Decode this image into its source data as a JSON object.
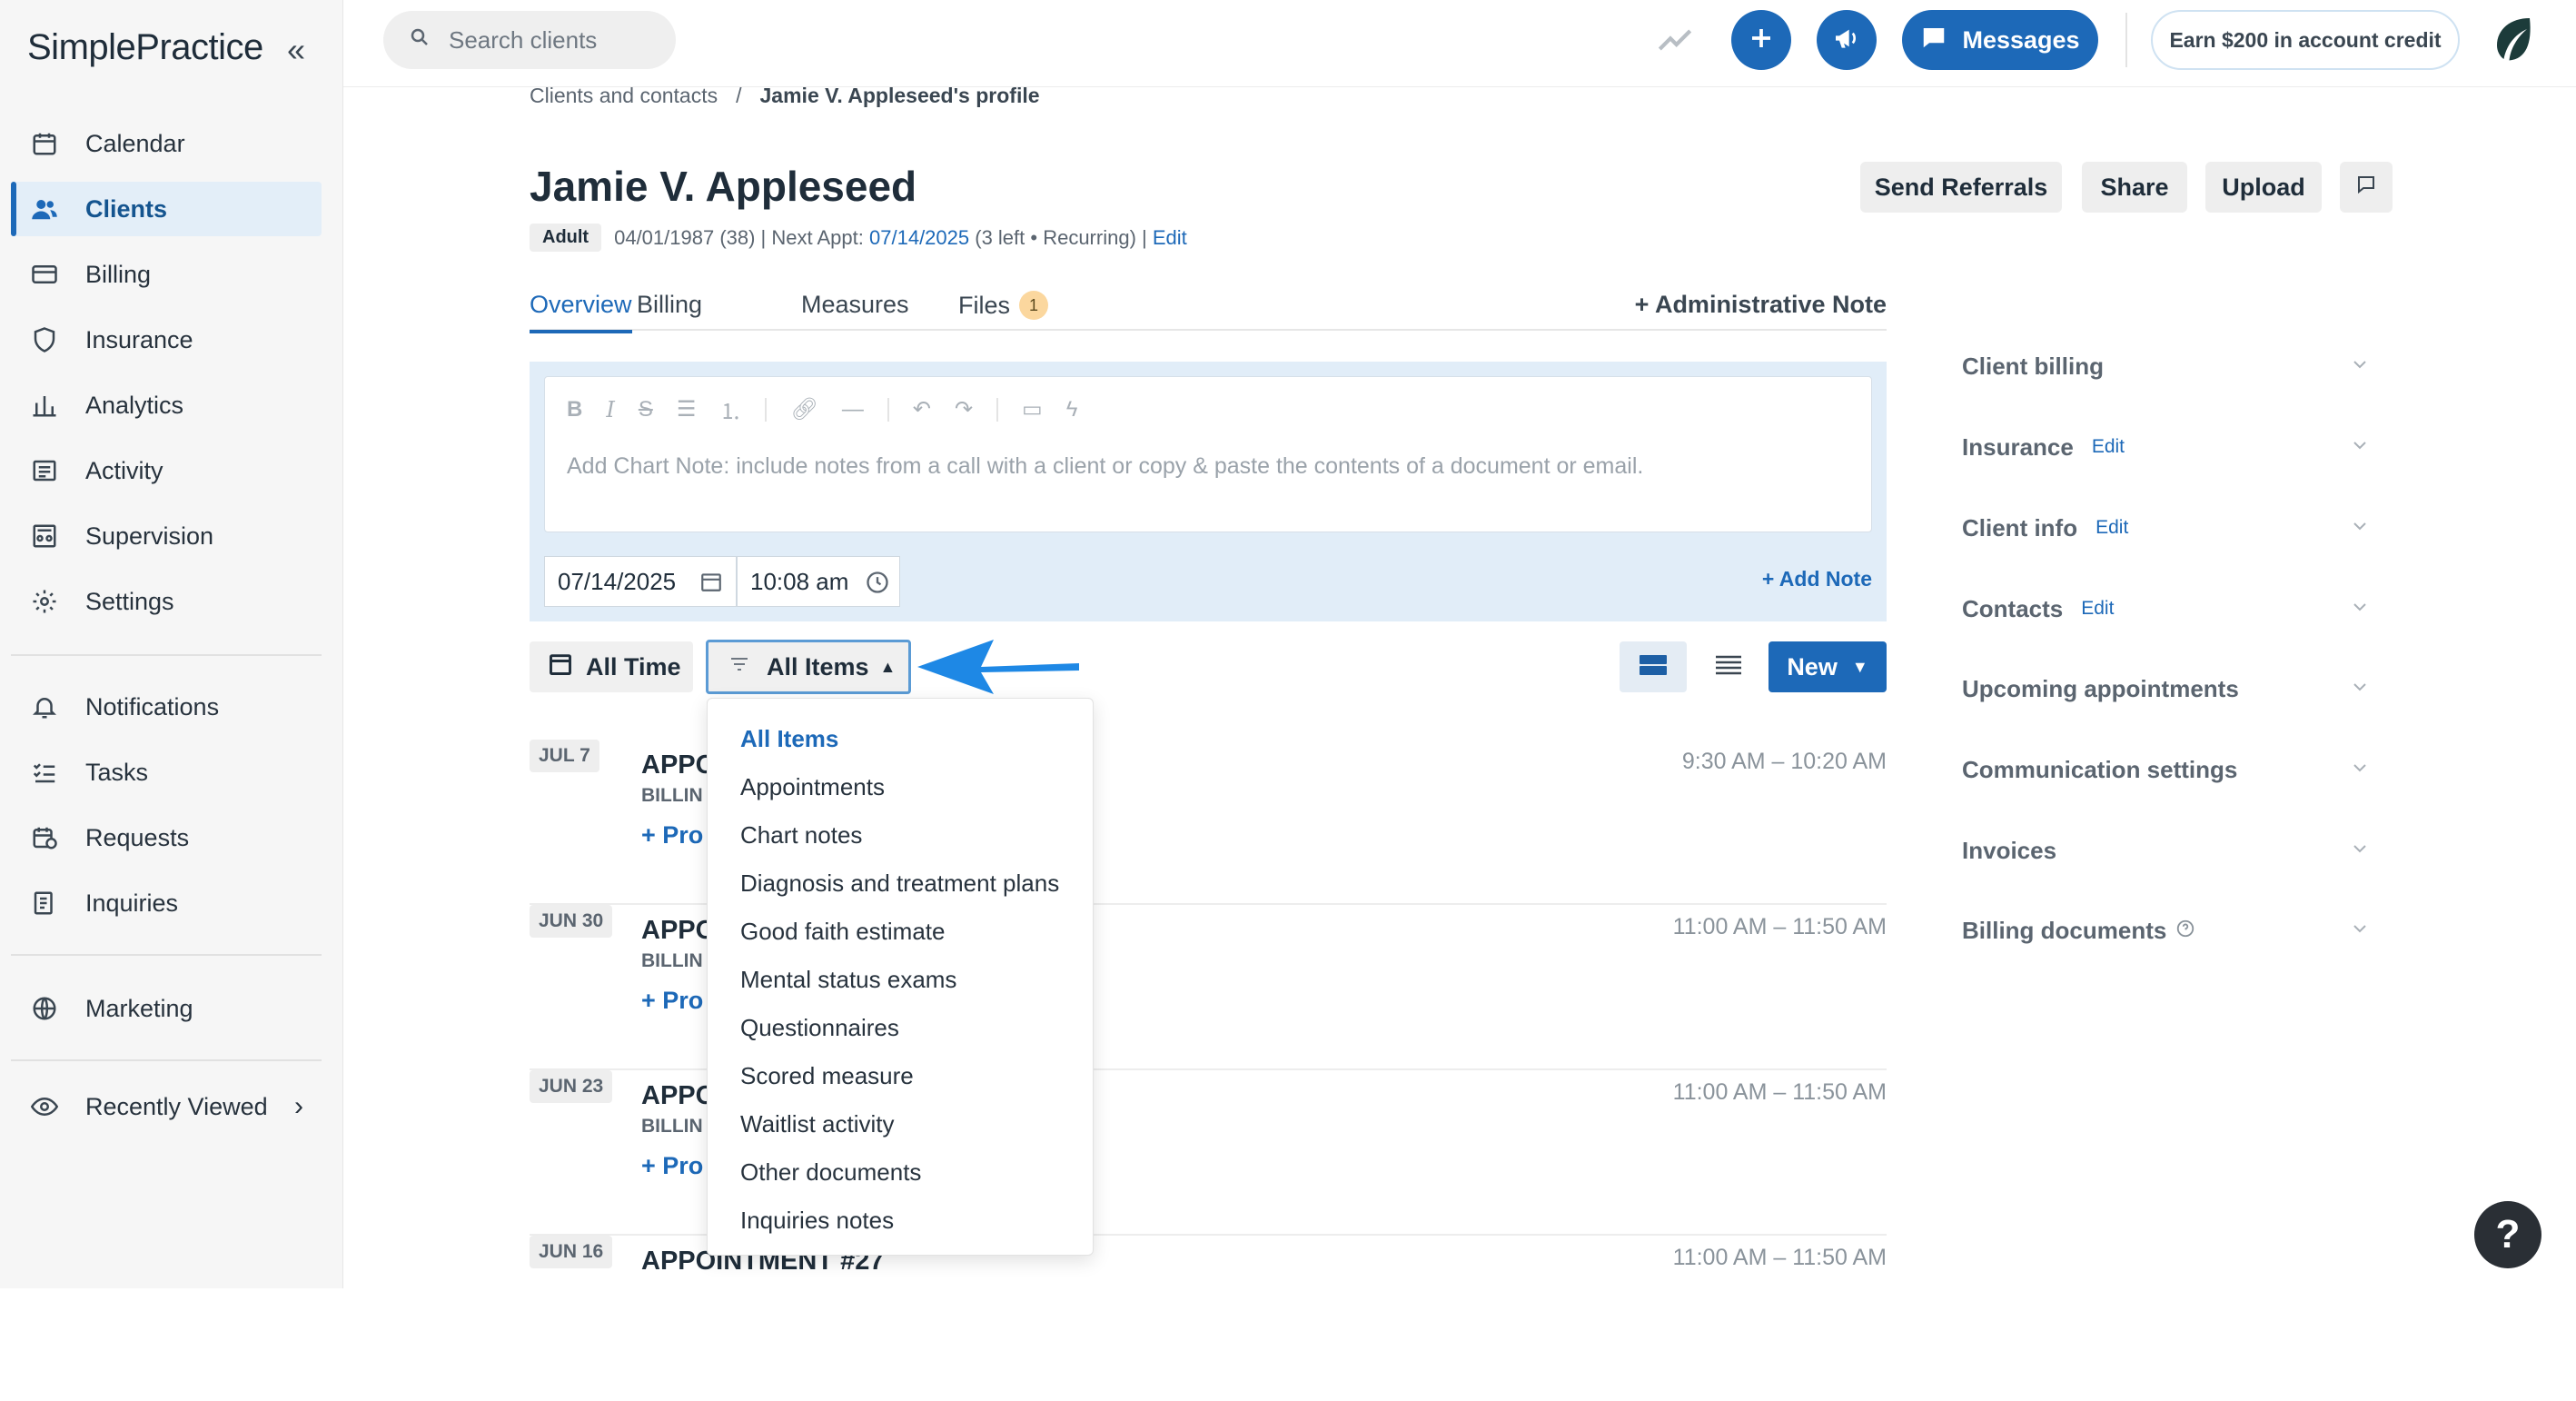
{
  "app": {
    "logo": "SimplePractice",
    "collapse_icon": "chevrons-left-icon"
  },
  "sidebar": {
    "items": [
      {
        "label": "Calendar",
        "icon": "calendar-icon"
      },
      {
        "label": "Clients",
        "icon": "users-icon",
        "active": true
      },
      {
        "label": "Billing",
        "icon": "credit-card-icon"
      },
      {
        "label": "Insurance",
        "icon": "shield-icon"
      },
      {
        "label": "Analytics",
        "icon": "bar-chart-icon"
      },
      {
        "label": "Activity",
        "icon": "list-icon"
      },
      {
        "label": "Supervision",
        "icon": "supervision-icon"
      },
      {
        "label": "Settings",
        "icon": "gear-icon"
      },
      {
        "label": "Notifications",
        "icon": "bell-icon"
      },
      {
        "label": "Tasks",
        "icon": "checklist-icon"
      },
      {
        "label": "Requests",
        "icon": "calendar-clock-icon"
      },
      {
        "label": "Inquiries",
        "icon": "document-list-icon"
      },
      {
        "label": "Marketing",
        "icon": "globe-icon"
      },
      {
        "label": "Recently Viewed",
        "icon": "eye-icon"
      }
    ]
  },
  "topbar": {
    "search_placeholder": "Search clients",
    "messages_label": "Messages",
    "earn_label": "Earn $200 in account credit"
  },
  "breadcrumb": {
    "parent": "Clients and contacts",
    "separator": "/",
    "current": "Jamie V. Appleseed's profile"
  },
  "client": {
    "name": "Jamie V. Appleseed",
    "badge": "Adult",
    "dob_prefix": "04/01/1987 (38) | Next Appt:",
    "next_appt": "07/14/2025",
    "appt_suffix": "(3 left • Recurring) |",
    "edit": "Edit"
  },
  "header_buttons": {
    "referrals": "Send Referrals",
    "share": "Share",
    "upload": "Upload"
  },
  "tabs": [
    {
      "label": "Overview",
      "active": true
    },
    {
      "label": "Billing"
    },
    {
      "label": "Measures"
    },
    {
      "label": "Files",
      "count": "1"
    }
  ],
  "admin_note": "+ Administrative Note",
  "chart_note": {
    "placeholder": "Add Chart Note: include notes from a call with a client or copy & paste the contents of a document or email.",
    "date": "07/14/2025",
    "time": "10:08 am",
    "add_label": "+ Add Note"
  },
  "filters": {
    "time": "All Time",
    "items": "All Items",
    "new": "New"
  },
  "dropdown": {
    "options": [
      "All Items",
      "Appointments",
      "Chart notes",
      "Diagnosis and treatment plans",
      "Good faith estimate",
      "Mental status exams",
      "Questionnaires",
      "Scored measure",
      "Waitlist activity",
      "Other documents",
      "Inquiries notes"
    ],
    "selected": "All Items"
  },
  "timeline": [
    {
      "date": "JUL 7",
      "title": "APPO",
      "sub": "BILLIN",
      "link": "+ Pro",
      "time": "9:30 AM – 10:20 AM"
    },
    {
      "date": "JUN 30",
      "title": "APPO",
      "sub": "BILLIN",
      "link": "+ Pro",
      "time": "11:00 AM – 11:50 AM"
    },
    {
      "date": "JUN 23",
      "title": "APPO",
      "sub": "BILLIN",
      "link": "+ Pro",
      "time": "11:00 AM – 11:50 AM"
    },
    {
      "date": "JUN 16",
      "title": "APPOINTMENT #27",
      "sub": "",
      "link": "",
      "time": "11:00 AM – 11:50 AM"
    }
  ],
  "right_panel": [
    {
      "label": "Client billing",
      "edit": ""
    },
    {
      "label": "Insurance",
      "edit": "Edit"
    },
    {
      "label": "Client info",
      "edit": "Edit"
    },
    {
      "label": "Contacts",
      "edit": "Edit"
    },
    {
      "label": "Upcoming appointments",
      "edit": ""
    },
    {
      "label": "Communication settings",
      "edit": ""
    },
    {
      "label": "Invoices",
      "edit": ""
    },
    {
      "label": "Billing documents",
      "edit": ""
    }
  ],
  "help_label": "?",
  "colors": {
    "accent": "#1d69b8",
    "active_nav_bg": "#e3eef8",
    "note_panel_bg": "#e1edf8",
    "arrow": "#1e88e5"
  }
}
